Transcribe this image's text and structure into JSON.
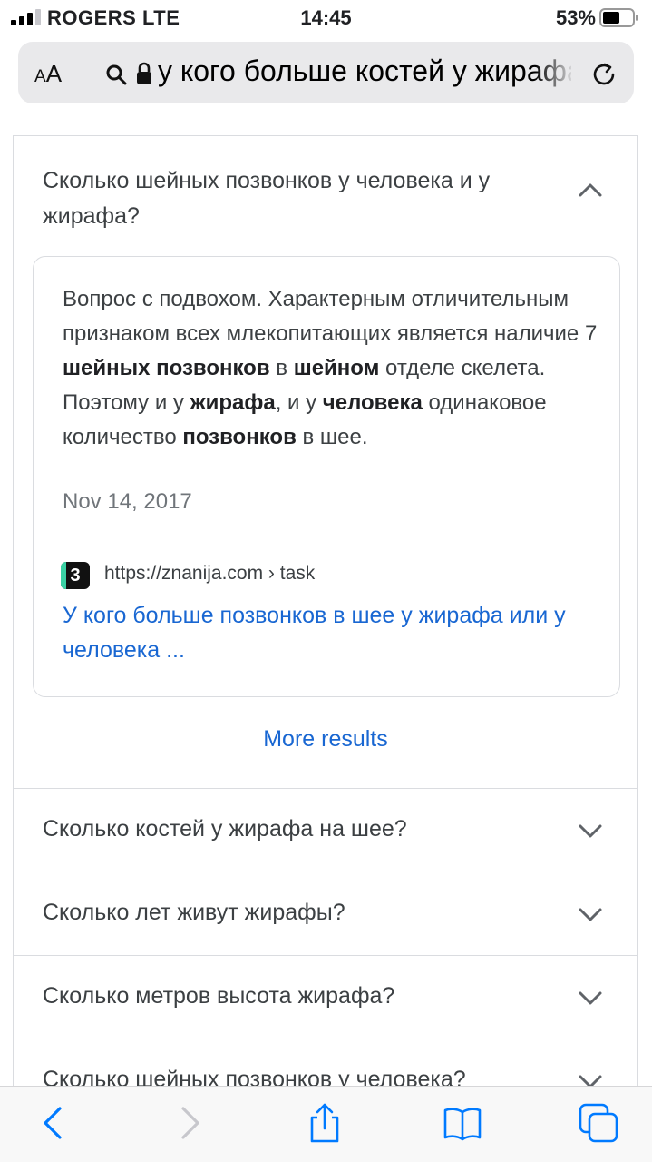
{
  "status_bar": {
    "carrier": "ROGERS LTE",
    "time": "14:45",
    "battery_percent": "53%",
    "signal_bars_active": 3,
    "signal_bars_total": 4
  },
  "address_bar": {
    "text_size_label": "AA",
    "url_text": "у кого больше костей у жирафа"
  },
  "open_question": {
    "question": "Сколько шейных позвонков у человека и у жирафа?",
    "answer_parts": [
      {
        "t": "Вопрос с подвохом. Характерным отличительным признаком всех млекопитающих является наличие 7 ",
        "b": false
      },
      {
        "t": "шейных позвонков",
        "b": true
      },
      {
        "t": " в ",
        "b": false
      },
      {
        "t": "шейном",
        "b": true
      },
      {
        "t": " отделе скелета. Поэтому и у ",
        "b": false
      },
      {
        "t": "жирафа",
        "b": true
      },
      {
        "t": ", и у ",
        "b": false
      },
      {
        "t": "человека",
        "b": true
      },
      {
        "t": " одинаковое количество ",
        "b": false
      },
      {
        "t": "позвонков",
        "b": true
      },
      {
        "t": " в шее.",
        "b": false
      }
    ],
    "date": "Nov 14, 2017",
    "favicon_letter": "3",
    "source_url": "https://znanija.com › task",
    "source_title": "У кого больше позвонков в шее у жирафа или у человека ..."
  },
  "more_results_label": "More results",
  "questions": [
    "Сколько костей у жирафа на шее?",
    "Сколько лет живут жирафы?",
    "Сколько метров высота жирафа?",
    "Сколько шейных позвонков у человека?"
  ],
  "toolbar": {
    "icons": [
      "back-icon",
      "forward-icon",
      "share-icon",
      "bookmarks-icon",
      "tabs-icon"
    ]
  },
  "colors": {
    "link": "#1967d2",
    "ios_blue": "#007aff",
    "divider": "#dadce0"
  }
}
